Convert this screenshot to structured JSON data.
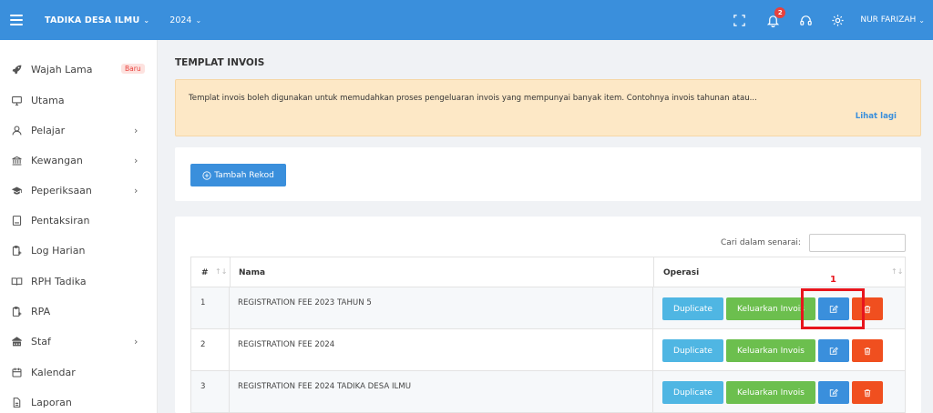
{
  "topbar": {
    "brand": "TADIKA DESA ILMU",
    "year": "2024",
    "notifications_count": "2",
    "user": "NUR FARIZAH",
    "icons": [
      "menu-icon",
      "fullscreen-icon",
      "bell-icon",
      "headset-icon",
      "gear-icon"
    ]
  },
  "sidebar": {
    "items": [
      {
        "label": "Wajah Lama",
        "icon": "rocket-icon",
        "badge": "Baru",
        "arrow": ""
      },
      {
        "label": "Utama",
        "icon": "monitor-icon",
        "badge": "",
        "arrow": ""
      },
      {
        "label": "Pelajar",
        "icon": "user-icon",
        "badge": "",
        "arrow": "›"
      },
      {
        "label": "Kewangan",
        "icon": "bank-icon",
        "badge": "",
        "arrow": "›"
      },
      {
        "label": "Peperiksaan",
        "icon": "graduation-icon",
        "badge": "",
        "arrow": "›"
      },
      {
        "label": "Pentaksiran",
        "icon": "book-icon",
        "badge": "",
        "arrow": ""
      },
      {
        "label": "Log Harian",
        "icon": "clipboard-icon",
        "badge": "",
        "arrow": ""
      },
      {
        "label": "RPH Tadika",
        "icon": "open-book-icon",
        "badge": "",
        "arrow": ""
      },
      {
        "label": "RPA",
        "icon": "clipboard-icon",
        "badge": "",
        "arrow": ""
      },
      {
        "label": "Staf",
        "icon": "building-icon",
        "badge": "",
        "arrow": "›"
      },
      {
        "label": "Kalendar",
        "icon": "calendar-icon",
        "badge": "",
        "arrow": ""
      },
      {
        "label": "Laporan",
        "icon": "report-icon",
        "badge": "",
        "arrow": ""
      }
    ]
  },
  "main": {
    "title": "TEMPLAT INVOIS",
    "notice_text": "Templat invois boleh digunakan untuk memudahkan proses pengeluaran invois yang mempunyai banyak item. Contohnya invois tahunan atau...",
    "notice_link": "Lihat lagi",
    "add_button": "Tambah Rekod",
    "search_label": "Cari dalam senarai:",
    "search_value": "",
    "table": {
      "headers": [
        "#",
        "Nama",
        "Operasi"
      ],
      "rows": [
        {
          "no": "1",
          "name": "REGISTRATION FEE 2023 TAHUN 5"
        },
        {
          "no": "2",
          "name": "REGISTRATION FEE 2024"
        },
        {
          "no": "3",
          "name": "REGISTRATION FEE 2024 TADIKA DESA ILMU"
        }
      ],
      "btn_duplicate": "Duplicate",
      "btn_keluarkan": "Keluarkan Invois"
    },
    "annotation_label": "1"
  },
  "colors": {
    "topbar": "#3a8fdc",
    "notice_bg": "#fde8c6",
    "duplicate": "#4fb6e3",
    "keluarkan": "#6cbf4e",
    "edit": "#3a8fdc",
    "delete": "#f04f1f",
    "highlight": "#e8151d"
  }
}
